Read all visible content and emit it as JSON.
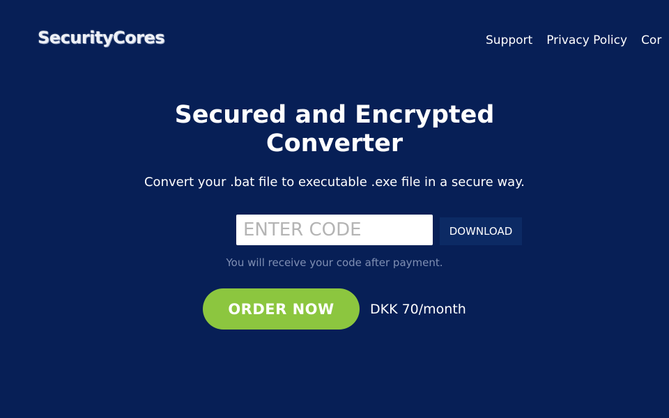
{
  "brand": {
    "logo_text": "SecurityCores"
  },
  "nav": {
    "items": [
      {
        "label": "Support"
      },
      {
        "label": "Privacy Policy"
      },
      {
        "label": "Cor"
      }
    ]
  },
  "hero": {
    "title": "Secured and Encrypted Converter",
    "subtitle": "Convert your .bat file to executable .exe file in a secure way."
  },
  "code_form": {
    "input_placeholder": "ENTER CODE",
    "input_value": "",
    "download_label": "DOWNLOAD",
    "hint": "You will receive your code after payment."
  },
  "order": {
    "button_label": "ORDER NOW",
    "price": "DKK 70/month"
  },
  "colors": {
    "background": "#071f56",
    "order_button": "#8cc63f",
    "download_button": "#0c2a64"
  }
}
